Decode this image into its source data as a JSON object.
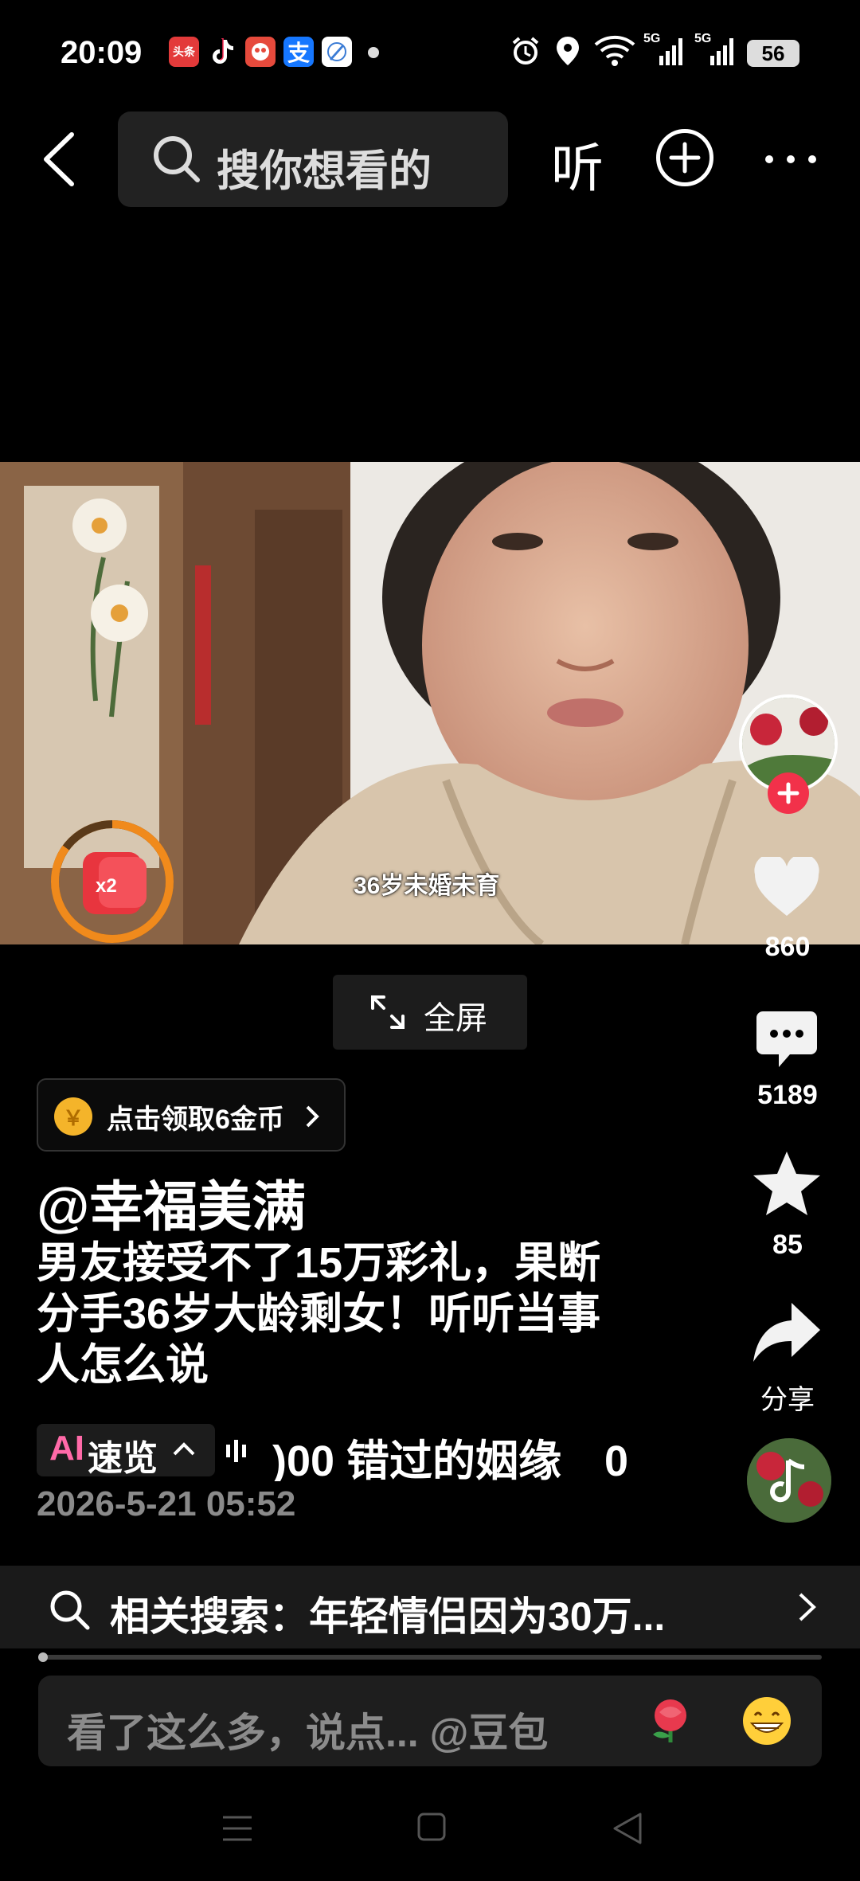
{
  "status_bar": {
    "time": "20:09",
    "apps": [
      {
        "name": "toutiao-app-icon",
        "text": "头条",
        "color": "#e33a3a"
      },
      {
        "name": "tiktok-app-icon",
        "text": "",
        "color": "#000000"
      },
      {
        "name": "game-app-icon",
        "text": "",
        "color": "#e64a3c"
      },
      {
        "name": "alipay-app-icon",
        "text": "支",
        "color": "#1677ff"
      },
      {
        "name": "browser-app-icon",
        "text": "",
        "color": "#3a7bd5"
      }
    ],
    "network_1": "5G",
    "network_2": "5G",
    "battery": "56"
  },
  "top_nav": {
    "search_placeholder": "搜你想看的",
    "listen_label": "听"
  },
  "video": {
    "subtitle": "36岁未婚未育",
    "red_packet_multiplier": "x2",
    "red_packet_progress": 0.85
  },
  "side_actions": {
    "likes": "860",
    "comments": "5189",
    "favorites": "85",
    "share_label": "分享"
  },
  "fullscreen_label": "全屏",
  "coin_chip": {
    "label": "点击领取6金币",
    "coin_symbol": "￥"
  },
  "author": "@幸福美满",
  "description_lines": [
    "男友接受不了15万彩礼，果断",
    "分手36岁大龄剩女！听听当事",
    "人怎么说"
  ],
  "ai_summary": {
    "ai": "AI",
    "label": "速览",
    "ticker": ")00 错过的姻缘　0"
  },
  "date": "2026-5-21 05:52",
  "related_search": {
    "label": "相关搜索：年轻情侣因为30万..."
  },
  "comment_bar": {
    "placeholder": "看了这么多，说点... @豆包"
  },
  "colors": {
    "accent_red": "#f2314a",
    "orange_ring": "#f08a1c",
    "background": "#000000"
  }
}
